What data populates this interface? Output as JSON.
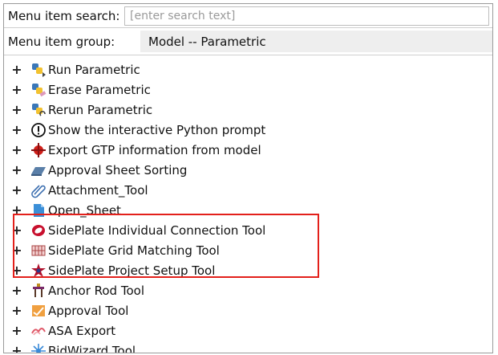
{
  "search": {
    "label": "Menu item search:",
    "placeholder": "[enter search text]"
  },
  "group": {
    "label": "Menu item group:",
    "value": "Model -- Parametric"
  },
  "tree": {
    "expander": "+",
    "items": [
      {
        "label": "Run Parametric",
        "icon": "python-run-icon"
      },
      {
        "label": "Erase Parametric",
        "icon": "python-erase-icon"
      },
      {
        "label": "Rerun Parametric",
        "icon": "python-rerun-icon"
      },
      {
        "label": "Show the interactive Python prompt",
        "icon": "info-circle-icon"
      },
      {
        "label": "Export GTP information from model",
        "icon": "target-icon"
      },
      {
        "label": "Approval Sheet Sorting",
        "icon": "sheet-stack-icon"
      },
      {
        "label": "Attachment_Tool",
        "icon": "paperclip-icon"
      },
      {
        "label": "Open_Sheet",
        "icon": "document-icon"
      },
      {
        "label": "SidePlate Individual Connection Tool",
        "icon": "sideplate-connection-icon"
      },
      {
        "label": "SidePlate Grid Matching Tool",
        "icon": "sideplate-grid-icon"
      },
      {
        "label": "SidePlate Project Setup Tool",
        "icon": "sideplate-setup-icon"
      },
      {
        "label": "Anchor Rod Tool",
        "icon": "anchor-rod-icon"
      },
      {
        "label": "Approval Tool",
        "icon": "approval-icon"
      },
      {
        "label": "ASA Export",
        "icon": "asa-export-icon"
      },
      {
        "label": "BidWizard Tool",
        "icon": "bidwizard-icon"
      }
    ]
  },
  "highlight_color": "#e3201b"
}
